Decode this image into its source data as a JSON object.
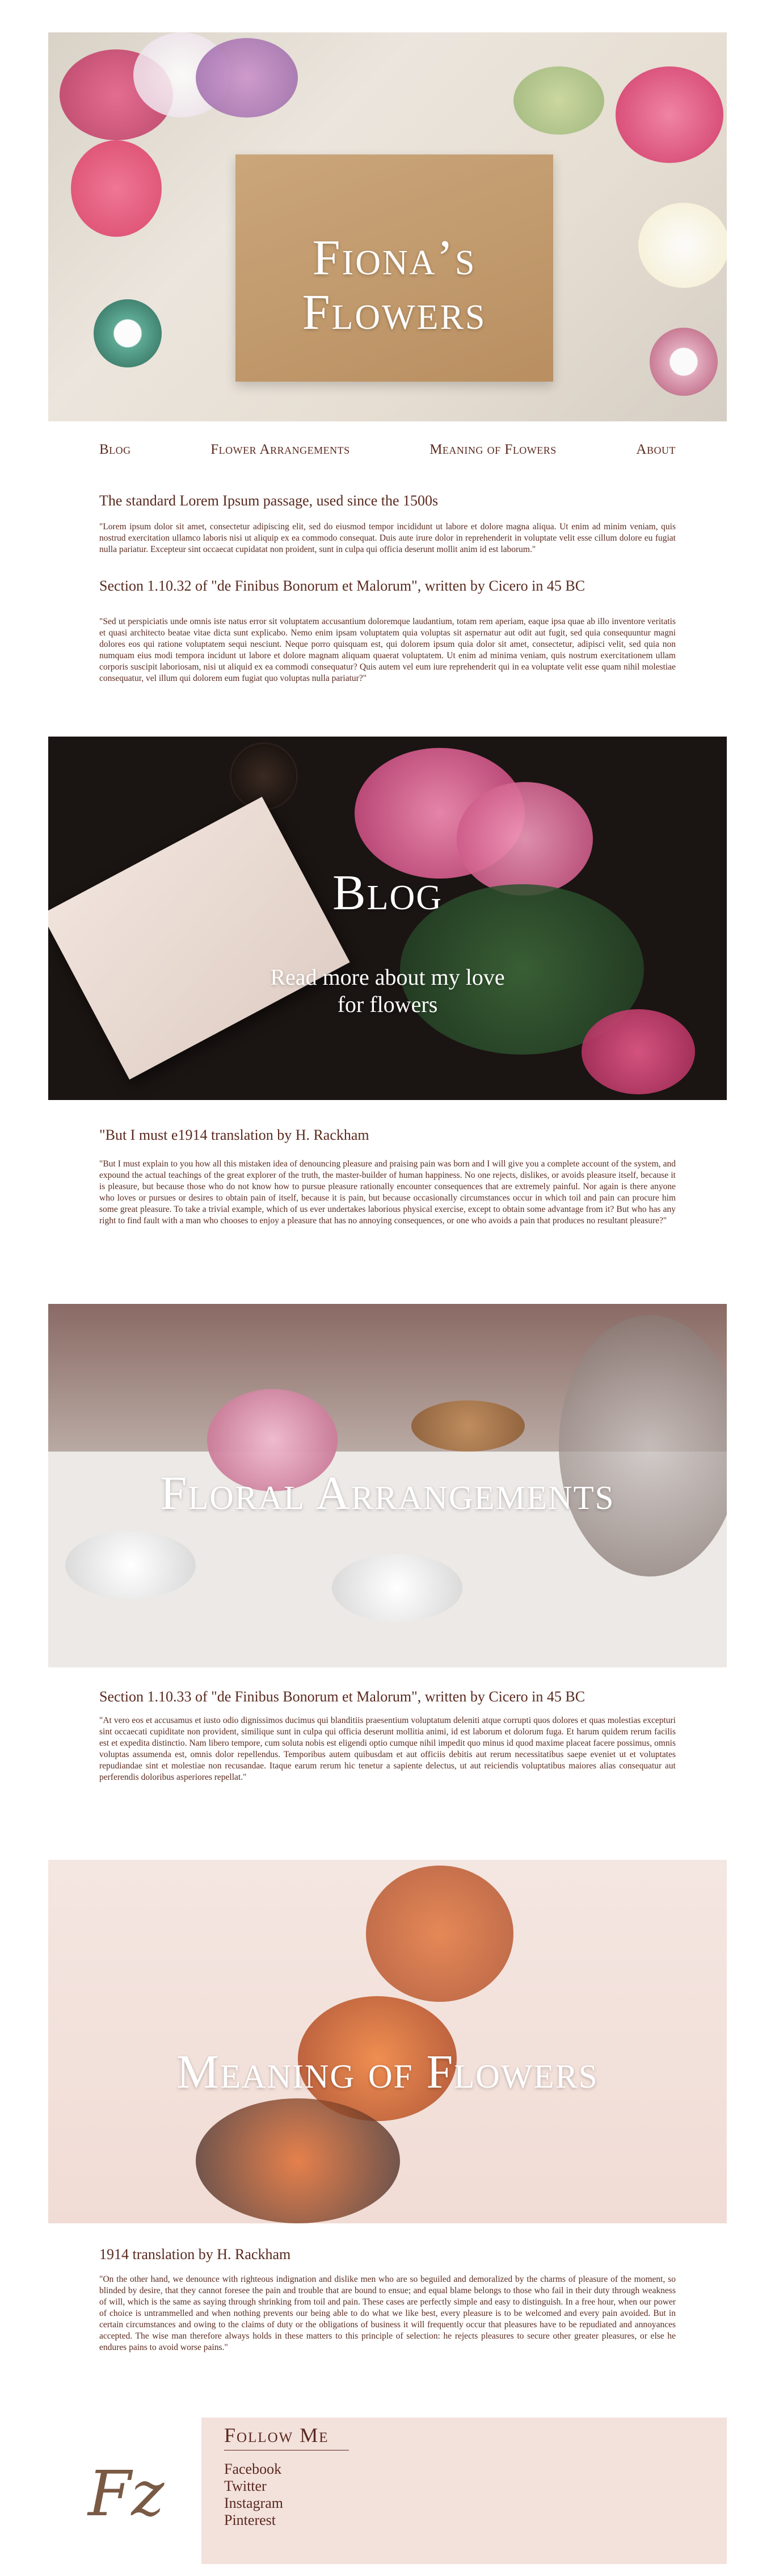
{
  "site": {
    "title": "Fiona’s Flowers"
  },
  "nav": [
    {
      "label": "Blog"
    },
    {
      "label": "Flower Arrangements"
    },
    {
      "label": "Meaning of Flowers"
    },
    {
      "label": "About"
    }
  ],
  "intro": {
    "heading": "The standard Lorem Ipsum passage, used since the 1500s",
    "text": "\"Lorem ipsum dolor sit amet, consectetur adipiscing elit, sed do eiusmod tempor incididunt ut labore et dolore magna aliqua. Ut enim ad minim veniam, quis nostrud exercitation ullamco laboris nisi ut aliquip ex ea commodo consequat. Duis aute irure dolor in reprehenderit in voluptate velit esse cillum dolore eu fugiat nulla pariatur. Excepteur sint occaecat cupidatat non proident, sunt in culpa qui officia deserunt mollit anim id est laborum.\""
  },
  "section1": {
    "heading": "Section 1.10.32 of \"de Finibus Bonorum et Malorum\", written by Cicero in 45 BC",
    "text": "\"Sed ut perspiciatis unde omnis iste natus error sit voluptatem accusantium doloremque laudantium, totam rem aperiam, eaque ipsa quae ab illo inventore veritatis et quasi architecto beatae vitae dicta sunt explicabo. Nemo enim ipsam voluptatem quia voluptas sit aspernatur aut odit aut fugit, sed quia consequuntur magni dolores eos qui ratione voluptatem sequi nesciunt. Neque porro quisquam est, qui dolorem ipsum quia dolor sit amet, consectetur, adipisci velit, sed quia non numquam eius modi tempora incidunt ut labore et dolore magnam aliquam quaerat voluptatem. Ut enim ad minima veniam, quis nostrum exercitationem ullam corporis suscipit laboriosam, nisi ut aliquid ex ea commodi consequatur? Quis autem vel eum iure reprehenderit qui in ea voluptate velit esse quam nihil molestiae consequatur, vel illum qui dolorem eum fugiat quo voluptas nulla pariatur?\""
  },
  "blog_panel": {
    "title": "Blog",
    "subtitle_line1": "Read more about my love",
    "subtitle_line2": "for flowers"
  },
  "section2": {
    "heading": "\"But I must e1914 translation by H. Rackham",
    "text": "\"But I must explain to you how all this mistaken idea of denouncing pleasure and praising pain was born and I will give you a complete account of the system, and expound the actual teachings of the great explorer of the truth, the master-builder of human happiness. No one rejects, dislikes, or avoids pleasure itself, because it is pleasure, but because those who do not know how to pursue pleasure rationally encounter consequences that are extremely painful. Nor again is there anyone who loves or pursues or desires to obtain pain of itself, because it is pain, but because occasionally circumstances occur in which toil and pain can procure him some great pleasure. To take a trivial example, which of us ever undertakes laborious physical exercise, except to obtain some advantage from it? But who has any right to find fault with a man who chooses to enjoy a pleasure that has no annoying consequences, or one who avoids a pain that produces no resultant pleasure?\""
  },
  "arrangements_panel": {
    "title": "Floral Arrangements"
  },
  "section3": {
    "heading": "Section 1.10.33 of \"de Finibus Bonorum et Malorum\", written by Cicero in 45 BC",
    "text": "\"At vero eos et accusamus et iusto odio dignissimos ducimus qui blanditiis praesentium voluptatum deleniti atque corrupti quos dolores et quas molestias excepturi sint occaecati cupiditate non provident, similique sunt in culpa qui officia deserunt mollitia animi, id est laborum et dolorum fuga. Et harum quidem rerum facilis est et expedita distinctio. Nam libero tempore, cum soluta nobis est eligendi optio cumque nihil impedit quo minus id quod maxime placeat facere possimus, omnis voluptas assumenda est, omnis dolor repellendus. Temporibus autem quibusdam et aut officiis debitis aut rerum necessitatibus saepe eveniet ut et voluptates repudiandae sint et molestiae non recusandae. Itaque earum rerum hic tenetur a sapiente delectus, ut aut reiciendis voluptatibus maiores alias consequatur aut perferendis doloribus asperiores repellat.\""
  },
  "meaning_panel": {
    "title": "Meaning of Flowers"
  },
  "section4": {
    "heading": "1914 translation by H. Rackham",
    "text": "\"On the other hand, we denounce with righteous indignation and dislike men who are so beguiled and demoralized by the charms of pleasure of the moment, so blinded by desire, that they cannot foresee the pain and trouble that are bound to ensue; and equal blame belongs to those who fail in their duty through weakness of will, which is the same as saying through shrinking from toil and pain. These cases are perfectly simple and easy to distinguish. In a free hour, when our power of choice is untrammelled and when nothing prevents our being able to do what we like best, every pleasure is to be welcomed and every pain avoided. But in certain circumstances and owing to the claims of duty or the obligations of business it will frequently occur that pleasures have to be repudiated and annoyances accepted. The wise man therefore always holds in these matters to this principle of selection: he rejects pleasures to secure other greater pleasures, or else he endures pains to avoid worse pains.\""
  },
  "footer": {
    "logo_text": "Fz",
    "follow_heading": "Follow Me",
    "links": [
      "Facebook",
      "Twitter",
      "Instagram",
      "Pinterest"
    ]
  },
  "colors": {
    "text": "#5a2a1f",
    "footer_bg": "#f3e1dc",
    "hero_paper": "#c19a6b"
  }
}
